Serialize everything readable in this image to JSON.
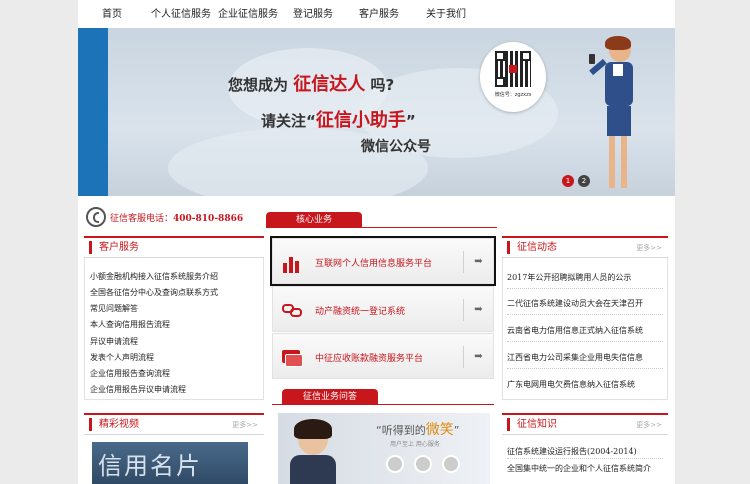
{
  "nav": {
    "items": [
      "首页",
      "个人征信服务",
      "企业征信服务",
      "登记服务",
      "客户服务",
      "关于我们"
    ]
  },
  "banner": {
    "line1_pre": "您想成为",
    "line1_em": "征信达人",
    "line1_post": "吗?",
    "line2_pre": "请关注“",
    "line2_em": "征信小助手",
    "line2_post": "”",
    "line3": "微信公众号",
    "wechat_label": "微信号：zgzxzs",
    "dots": [
      "1",
      "2"
    ]
  },
  "hotline": {
    "label": "征信客服电话：",
    "number": "400-810-8866"
  },
  "core_tab": "核心业务",
  "qa_tab": "征信业务问答",
  "customer_service": {
    "title": "客户服务",
    "items": [
      "小额金融机构接入征信系统服务介绍",
      "全国各征信分中心及查询点联系方式",
      "常见问题解答",
      "本人查询信用报告流程",
      "异议申请流程",
      "发表个人声明流程",
      "企业信用报告查询流程",
      "企业信用报告异议申请流程"
    ]
  },
  "business": [
    {
      "label": "互联网个人信用信息服务平台",
      "icon": "chart-icon"
    },
    {
      "label": "动产融资统一登记系统",
      "icon": "chain-icon"
    },
    {
      "label": "中征应收账款融资服务平台",
      "icon": "card-icon"
    }
  ],
  "news": {
    "title": "征信动态",
    "more": "更多>>",
    "items": [
      "2017年公开招聘拟聘用人员的公示",
      "二代征信系统建设动员大会在天津召开",
      "云南省电力信用信息正式纳入征信系统",
      "江西省电力公司采集企业用电失信信息",
      "广东电网用电欠费信息纳入征信系统"
    ]
  },
  "video": {
    "title": "精彩视频",
    "more": "更多>>",
    "thumb_text": "信用名片"
  },
  "qa_banner": {
    "text_pre": "听得到的",
    "text_em": "微笑",
    "sub": "用户至上  用心服务"
  },
  "knowledge": {
    "title": "征信知识",
    "more": "更多>>",
    "items": [
      "征信系统建设运行报告(2004-2014)",
      "全国集中统一的企业和个人征信系统简介"
    ]
  },
  "colors": {
    "brand_red": "#c8161d",
    "banner_blue": "#cfdbe6"
  }
}
